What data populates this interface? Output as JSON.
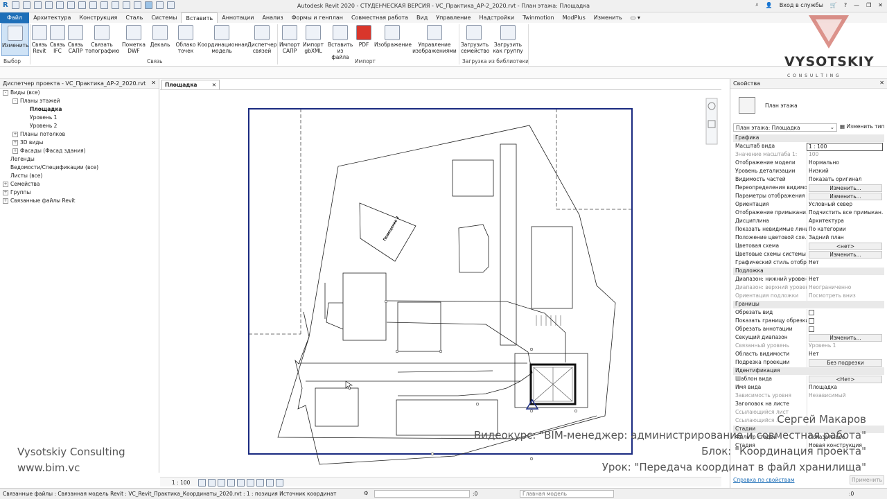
{
  "app": {
    "title": "Autodesk Revit 2020 - СТУДЕНЧЕСКАЯ ВЕРСИЯ - VC_Практика_АР-2_2020.rvt - План этажа: Площадка",
    "signin": "Вход в службы"
  },
  "menu": [
    "Файл",
    "Архитектура",
    "Конструкция",
    "Сталь",
    "Системы",
    "Вставить",
    "Аннотации",
    "Анализ",
    "Формы и генплан",
    "Совместная работа",
    "Вид",
    "Управление",
    "Надстройки",
    "Twinmotion",
    "ModPlus",
    "Изменить"
  ],
  "ribbon": {
    "buttons": [
      {
        "label": "Изменить"
      },
      {
        "label": "Связь Revit"
      },
      {
        "label": "Связь IFC"
      },
      {
        "label": "Связь САПР"
      },
      {
        "label": "Связать топографию"
      },
      {
        "label": "Пометка DWF"
      },
      {
        "label": "Декаль"
      },
      {
        "label": "Облако точек"
      },
      {
        "label": "Координационная модель"
      },
      {
        "label": "Диспетчер связей"
      },
      {
        "label": "Импорт САПР"
      },
      {
        "label": "Импорт gbXML"
      },
      {
        "label": "Вставить из файла"
      },
      {
        "label": "PDF"
      },
      {
        "label": "Изображение"
      },
      {
        "label": "Управление изображениями"
      },
      {
        "label": "Загрузить семейство"
      },
      {
        "label": "Загрузить как группу"
      }
    ],
    "panels": {
      "select": "Выбор",
      "link": "Связь",
      "import": "Импорт",
      "library": "Загрузка из библиотеки"
    }
  },
  "project_browser": {
    "title": "Диспетчер проекта - VC_Практика_АР-2_2020.rvt",
    "items": [
      {
        "label": "Виды (все)",
        "level": 0,
        "exp": "-"
      },
      {
        "label": "Планы этажей",
        "level": 1,
        "exp": "-"
      },
      {
        "label": "Площадка",
        "level": 2,
        "exp": "",
        "bold": true
      },
      {
        "label": "Уровень 1",
        "level": 2,
        "exp": ""
      },
      {
        "label": "Уровень 2",
        "level": 2,
        "exp": ""
      },
      {
        "label": "Планы потолков",
        "level": 1,
        "exp": "+"
      },
      {
        "label": "3D виды",
        "level": 1,
        "exp": "+"
      },
      {
        "label": "Фасады (Фасад здания)",
        "level": 1,
        "exp": "+"
      },
      {
        "label": "Легенды",
        "level": 0,
        "exp": ""
      },
      {
        "label": "Ведомости/Спецификации (все)",
        "level": 0,
        "exp": ""
      },
      {
        "label": "Листы (все)",
        "level": 0,
        "exp": ""
      },
      {
        "label": "Семейства",
        "level": 0,
        "exp": "+"
      },
      {
        "label": "Группы",
        "level": 0,
        "exp": "+"
      },
      {
        "label": "Связанные файлы Revit",
        "level": 0,
        "exp": "+"
      }
    ]
  },
  "view_tab": {
    "label": "Площадка",
    "close": "✕"
  },
  "drawing": {
    "room_label": "Помещение 2"
  },
  "view_controls": {
    "scale": "1 : 100"
  },
  "properties": {
    "title": "Свойства",
    "type_name": "План этажа",
    "selector": "План этажа: Площадка",
    "edit_type": "Изменить тип",
    "rows": [
      {
        "kind": "section",
        "label": "Графика"
      },
      {
        "k": "Масштаб вида",
        "v": "1 : 100",
        "input": true
      },
      {
        "k": "Значение масштаба    1:",
        "v": "100",
        "gray": true
      },
      {
        "k": "Отображение модели",
        "v": "Нормально"
      },
      {
        "k": "Уровень детализации",
        "v": "Низкий"
      },
      {
        "k": "Видимость частей",
        "v": "Показать оригинал"
      },
      {
        "k": "Переопределения видимо...",
        "v": "Изменить...",
        "btn": true
      },
      {
        "k": "Параметры отображения ...",
        "v": "Изменить...",
        "btn": true
      },
      {
        "k": "Ориентация",
        "v": "Условный север"
      },
      {
        "k": "Отображение примыкани...",
        "v": "Подчистить все примыкан..."
      },
      {
        "k": "Дисциплина",
        "v": "Архитектура"
      },
      {
        "k": "Показать невидимые линии",
        "v": "По категории"
      },
      {
        "k": "Положение цветовой схе...",
        "v": "Задний план"
      },
      {
        "k": "Цветовая схема",
        "v": "<нет>",
        "btn": true
      },
      {
        "k": "Цветовые схемы системы",
        "v": "Изменить...",
        "btn": true
      },
      {
        "k": "Графический стиль отобр...",
        "v": "Нет"
      },
      {
        "kind": "section",
        "label": "Подложка"
      },
      {
        "k": "Диапазон: нижний уровень",
        "v": "Нет"
      },
      {
        "k": "Диапазон: верхний уровень",
        "v": "Неограниченно",
        "gray": true
      },
      {
        "k": "Ориентация подложки",
        "v": "Посмотреть вниз",
        "gray": true
      },
      {
        "kind": "section",
        "label": "Границы"
      },
      {
        "k": "Обрезать вид",
        "v": "",
        "check": true
      },
      {
        "k": "Показать границу обрезки",
        "v": "",
        "check": true
      },
      {
        "k": "Обрезать аннотации",
        "v": "",
        "check": true
      },
      {
        "k": "Секущий диапазон",
        "v": "Изменить...",
        "btn": true
      },
      {
        "k": "Связанный уровень",
        "v": "Уровень 1",
        "gray": true
      },
      {
        "k": "Область видимости",
        "v": "Нет"
      },
      {
        "k": "Подрезка проекции",
        "v": "Без подрезки",
        "btn": true
      },
      {
        "kind": "section",
        "label": "Идентификация"
      },
      {
        "k": "Шаблон вида",
        "v": "<Нет>",
        "btn": true
      },
      {
        "k": "Имя вида",
        "v": "Площадка"
      },
      {
        "k": "Зависимость уровня",
        "v": "Независимый",
        "gray": true
      },
      {
        "k": "Заголовок на листе",
        "v": ""
      },
      {
        "k": "Ссылающийся лист",
        "v": "",
        "gray": true
      },
      {
        "k": "Ссылающийся ...",
        "v": "",
        "gray": true
      },
      {
        "kind": "section",
        "label": "Стадии"
      },
      {
        "k": "Фильтр стадий",
        "v": "Показать все"
      },
      {
        "k": "Стадия",
        "v": "Новая конструкция"
      }
    ],
    "help_link": "Справка по свойствам",
    "apply": "Применить"
  },
  "status": {
    "text": "Связанные файлы : Связанная модель Revit : VC_Revit_Практика_Координаты_2020.rvt : 1 : позиция Источник координат",
    "zero1": ":0",
    "model": "Главная модель",
    "zero2": ":0"
  },
  "overlay": {
    "company": "Vysotskiy Consulting",
    "site": "www.bim.vc",
    "author": "Сергей Макаров",
    "course": "Видеокурс: \"BIM-менеджер: администрирование и совместная работа\"",
    "block": "Блок: \"Координация проекта\"",
    "lesson": "Урок: \"Передача координат в файл хранилища\"",
    "logo_name": "VYSOTSKIY",
    "logo_sub": "C O N S U L T I N G"
  },
  "colors": {
    "accent": "#1e6fb8",
    "crop": "#1a2a80",
    "logo": "#c0392b"
  }
}
